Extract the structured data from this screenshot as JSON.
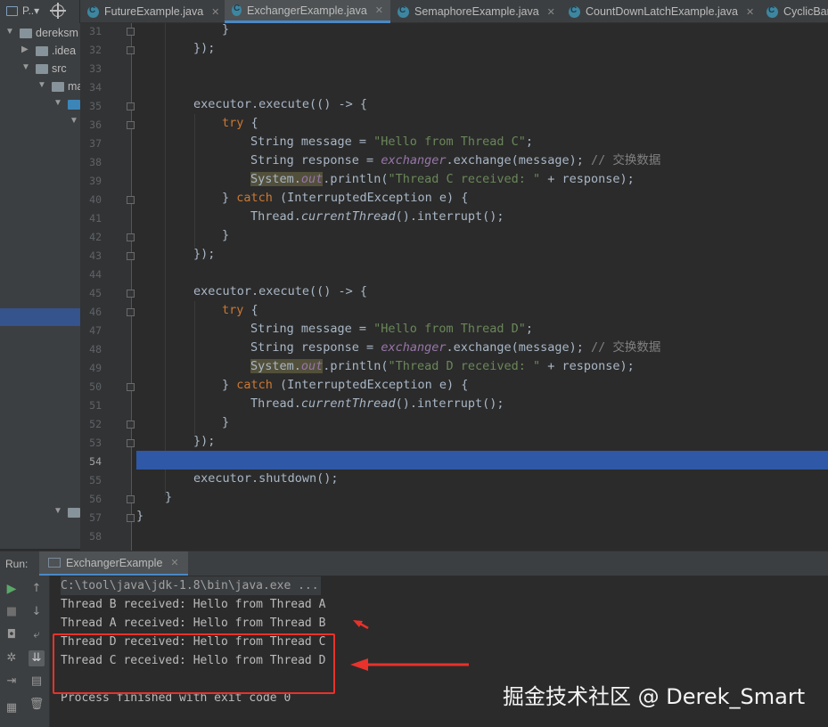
{
  "tabs": {
    "project_label": "P..▾",
    "files": [
      {
        "label": "FutureExample.java"
      },
      {
        "label": "ExchangerExample.java"
      },
      {
        "label": "SemaphoreExample.java"
      },
      {
        "label": "CountDownLatchExample.java"
      },
      {
        "label": "CyclicBar"
      }
    ]
  },
  "tree": {
    "items": [
      {
        "label": "dereksm"
      },
      {
        "label": ".idea"
      },
      {
        "label": "src"
      },
      {
        "label": "ma"
      }
    ]
  },
  "editor": {
    "line_numbers": [
      "31",
      "32",
      "33",
      "34",
      "35",
      "36",
      "37",
      "38",
      "39",
      "40",
      "41",
      "42",
      "43",
      "44",
      "45",
      "46",
      "47",
      "48",
      "49",
      "50",
      "51",
      "52",
      "53",
      "54",
      "55",
      "56",
      "57",
      "58"
    ],
    "code": {
      "l31": "}",
      "l32": "});",
      "l35_a": "executor.execute(() -> {",
      "l36_kw": "try",
      "l36_b": " {",
      "l37_a": "String message = ",
      "l37_str": "\"Hello from Thread C\"",
      "l37_b": ";",
      "l38_a": "String response = ",
      "l38_fld": "exchanger",
      "l38_b": ".exchange(message); ",
      "l38_cmt": "// 交换数据",
      "l39_sys": "System.",
      "l39_out": "out",
      "l39_a": ".println(",
      "l39_str": "\"Thread C received: \"",
      "l39_b": " + response);",
      "l40_a": "} ",
      "l40_kw": "catch",
      "l40_b": " (InterruptedException e) {",
      "l41_a": "Thread.",
      "l41_it": "currentThread",
      "l41_b": "().interrupt();",
      "l42": "}",
      "l43": "});",
      "l45_a": "executor.execute(() -> {",
      "l46_kw": "try",
      "l46_b": " {",
      "l47_a": "String message = ",
      "l47_str": "\"Hello from Thread D\"",
      "l47_b": ";",
      "l48_a": "String response = ",
      "l48_fld": "exchanger",
      "l48_b": ".exchange(message); ",
      "l48_cmt": "// 交换数据",
      "l49_sys": "System.",
      "l49_out": "out",
      "l49_a": ".println(",
      "l49_str": "\"Thread D received: \"",
      "l49_b": " + response);",
      "l50_a": "} ",
      "l50_kw": "catch",
      "l50_b": " (InterruptedException e) {",
      "l51_a": "Thread.",
      "l51_it": "currentThread",
      "l51_b": "().interrupt();",
      "l52": "}",
      "l53": "});",
      "l55": "executor.shutdown();",
      "l56": "}",
      "l57": "}"
    }
  },
  "run": {
    "label": "Run:",
    "tab": "ExchangerExample",
    "console": [
      "C:\\tool\\java\\jdk-1.8\\bin\\java.exe ...",
      "Thread B received: Hello from Thread A",
      "Thread A received: Hello from Thread B",
      "Thread D received: Hello from Thread C",
      "Thread C received: Hello from Thread D",
      "Process finished with exit code 0"
    ]
  },
  "watermark": "掘金技术社区 @ Derek_Smart",
  "colors": {
    "annotation_red": "#e8322b",
    "keyword": "#cc7832",
    "string": "#6a8759",
    "line_highlight": "#2f58a6"
  }
}
